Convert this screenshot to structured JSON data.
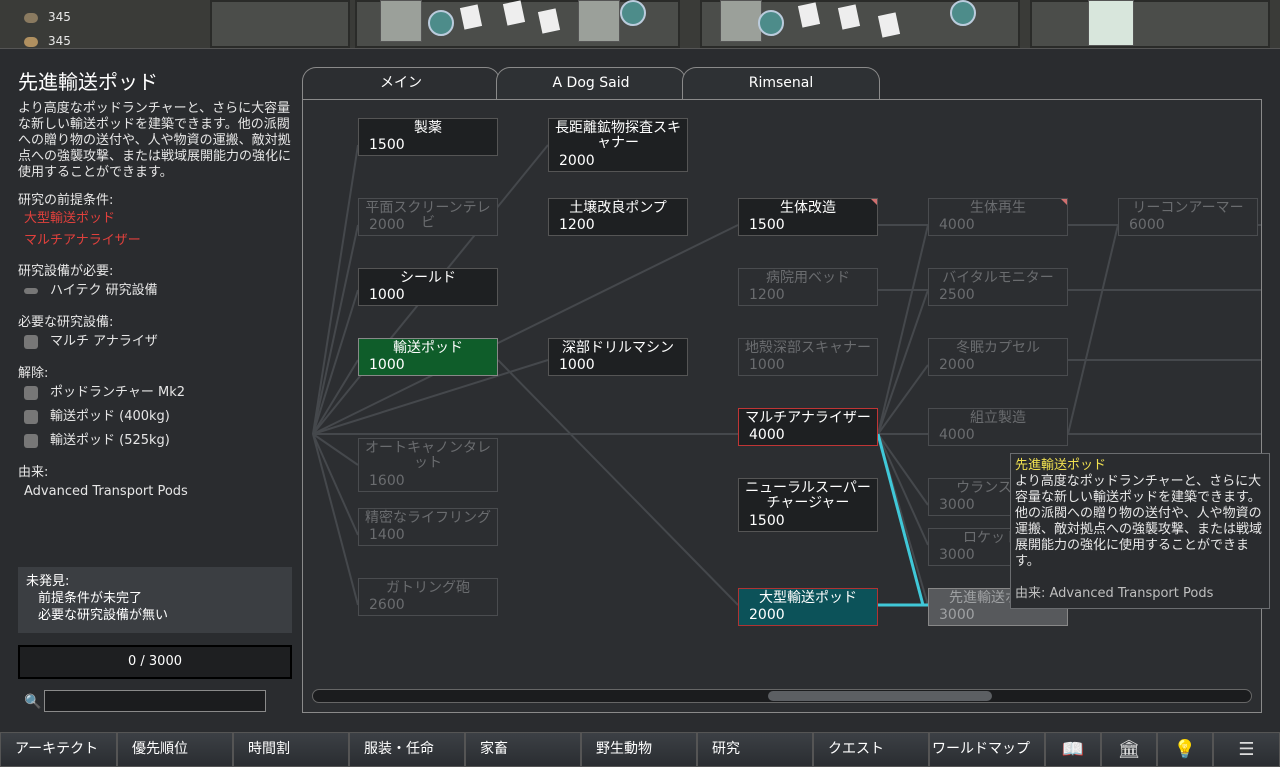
{
  "world": {
    "res1": "345",
    "res2": "345"
  },
  "info": {
    "title": "先進輸送ポッド",
    "description": "より高度なポッドランチャーと、さらに大容量な新しい輸送ポッドを建築できます。他の派閥への贈り物の送付や、人や物資の運搬、敵対拠点への強襲攻撃、または戦域展開能力の強化に使用することができます。",
    "prereq_label": "研究の前提条件:",
    "prereqs": [
      "大型輸送ポッド",
      "マルチアナライザー"
    ],
    "bench_label": "研究設備が必要:",
    "bench": "ハイテク 研究設備",
    "facility_label": "必要な研究設備:",
    "facility": "マルチ アナライザ",
    "unlocks_label": "解除:",
    "unlocks": [
      "ポッドランチャー Mk2",
      "輸送ポッド (400kg)",
      "輸送ポッド (525kg)"
    ],
    "source_label": "由来:",
    "source": "Advanced Transport Pods",
    "undiscovered_title": "未発見:",
    "undiscovered_lines": [
      "前提条件が未完了",
      "必要な研究設備が無い"
    ],
    "progress": "0 / 3000",
    "search_value": ""
  },
  "tabs": [
    "メイン",
    "A Dog Said",
    "Rimsenal"
  ],
  "nodes": [
    {
      "name": "製薬",
      "cost": "1500"
    },
    {
      "name": "長距離鉱物探査スキャナー",
      "cost": "2000"
    },
    {
      "name": "平面スクリーンテレビ",
      "cost": "2000"
    },
    {
      "name": "土壌改良ポンプ",
      "cost": "1200"
    },
    {
      "name": "生体改造",
      "cost": "1500"
    },
    {
      "name": "生体再生",
      "cost": "4000"
    },
    {
      "name": "リーコンアーマー",
      "cost": "6000"
    },
    {
      "name": "シールド",
      "cost": "1000"
    },
    {
      "name": "病院用ベッド",
      "cost": "1200"
    },
    {
      "name": "バイタルモニター",
      "cost": "2500"
    },
    {
      "name": "輸送ポッド",
      "cost": "1000"
    },
    {
      "name": "深部ドリルマシン",
      "cost": "1000"
    },
    {
      "name": "地殻深部スキャナー",
      "cost": "1000"
    },
    {
      "name": "冬眠カプセル",
      "cost": "2000"
    },
    {
      "name": "マルチアナライザー",
      "cost": "4000"
    },
    {
      "name": "組立製造",
      "cost": "4000"
    },
    {
      "name": "オートキャノンタレット",
      "cost": "1600"
    },
    {
      "name": "ニューラルスーパーチャージャー",
      "cost": "1500"
    },
    {
      "name": "ウランスラグ",
      "cost": "3000"
    },
    {
      "name": "精密なライフリング",
      "cost": "1400"
    },
    {
      "name": "ロケット弾",
      "cost": "3000"
    },
    {
      "name": "ガトリング砲",
      "cost": "2600"
    },
    {
      "name": "大型輸送ポッド",
      "cost": "2000"
    },
    {
      "name": "先進輸送ポッド",
      "cost": "3000"
    }
  ],
  "tooltip": {
    "title": "先進輸送ポッド",
    "body": "より高度なポッドランチャーと、さらに大容量な新しい輸送ポッドを建築できます。他の派閥への贈り物の送付や、人や物資の運搬、敵対拠点への強襲攻撃、または戦域展開能力の強化に使用することができます。",
    "source": "由来: Advanced Transport Pods"
  },
  "bottom_tabs": [
    "アーキテクト",
    "優先順位",
    "時間割",
    "服装・任命",
    "家畜",
    "野生動物",
    "研究",
    "クエスト",
    "ワールドマップ"
  ],
  "bottom_icons": [
    "book-icon",
    "bank-icon",
    "lightbulb-icon",
    "menu-icon"
  ]
}
